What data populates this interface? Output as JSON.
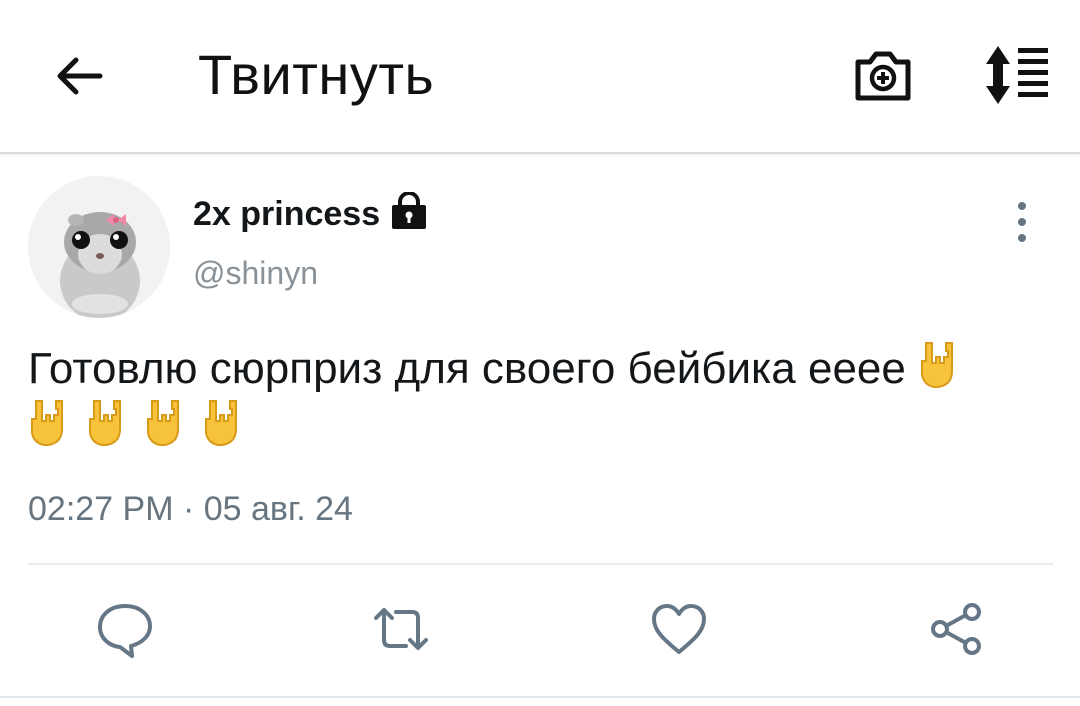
{
  "header": {
    "title": "Твитнуть",
    "back_icon": "arrow-left-icon",
    "camera_icon": "camera-add-icon",
    "sort_icon": "sort-list-icon"
  },
  "tweet": {
    "display_name": "2x princess",
    "username": "@shinyn",
    "protected_icon": "lock-icon",
    "text": "Готовлю сюрприз для своего бейбика ееее",
    "emoji": "🤘",
    "emoji_count": 5,
    "timestamp": "02:27 PM · 05 авг. 24"
  },
  "actions": [
    "reply-icon",
    "retweet-icon",
    "like-icon",
    "share-icon"
  ],
  "colors": {
    "icon_gray": "#657786",
    "name_text": "#14171a",
    "secondary_text": "#66757f",
    "divider": "#e6ecf0",
    "emoji_yellow": "#f7c33a"
  }
}
